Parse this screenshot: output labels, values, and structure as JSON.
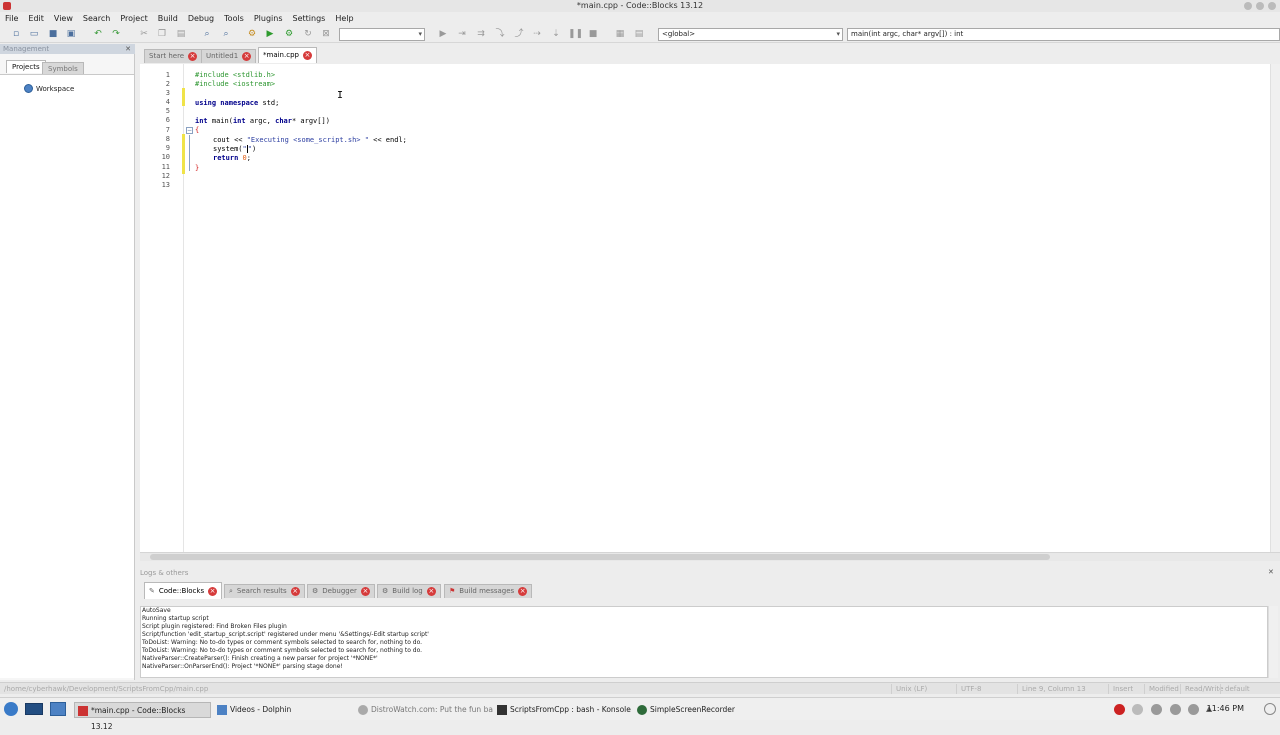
{
  "window": {
    "title": "*main.cpp - Code::Blocks 13.12"
  },
  "menu": [
    "File",
    "Edit",
    "View",
    "Search",
    "Project",
    "Build",
    "Debug",
    "Tools",
    "Plugins",
    "Settings",
    "Help"
  ],
  "toolbar": {
    "target_combo": "",
    "scope_combo": "<global>",
    "function_combo": "main(int argc, char* argv[]) : int"
  },
  "management": {
    "title": "Management",
    "tabs": [
      "Projects",
      "Symbols"
    ],
    "tree_root": "Workspace"
  },
  "editor_tabs": [
    {
      "label": "Start here",
      "active": false
    },
    {
      "label": "Untitled1",
      "active": false
    },
    {
      "label": "*main.cpp",
      "active": true
    }
  ],
  "code": {
    "line_numbers": [
      "1",
      "2",
      "3",
      "4",
      "5",
      "6",
      "7",
      "8",
      "9",
      "10",
      "11",
      "12",
      "13"
    ],
    "lines": {
      "l1": "#include <stdlib.h>",
      "l2": "#include <iostream>",
      "l4_kw1": "using",
      "l4_kw2": "namespace",
      "l4_rest": " std;",
      "l6_kw1": "int",
      "l6_mid": " main(",
      "l6_kw2": "int",
      "l6_mid2": " argc, ",
      "l6_kw3": "char",
      "l6_end": "* argv[])",
      "l7": "{",
      "l8_a": "cout << ",
      "l8_str": "\"Executing <some_script.sh> \"",
      "l8_b": " << endl;",
      "l9_a": "system(",
      "l9_str": "\"",
      "l9_b": ")",
      "l10_kw": "return",
      "l10_num": " 0",
      "l10_end": ";",
      "l11": "}"
    }
  },
  "logs": {
    "title": "Logs & others",
    "tabs": [
      "Code::Blocks",
      "Search results",
      "Debugger",
      "Build log",
      "Build messages"
    ],
    "lines": [
      "AutoSave",
      "Running startup script",
      "Script plugin registered: Find Broken Files plugin",
      "Script/function 'edit_startup_script.script' registered under menu '&Settings/-Edit startup script'",
      "ToDoList: Warning: No to-do types or comment symbols selected to search for, nothing to do.",
      "ToDoList: Warning: No to-do types or comment symbols selected to search for, nothing to do.",
      "NativeParser::CreateParser(): Finish creating a new parser for project '*NONE*'",
      "NativeParser::OnParserEnd(): Project '*NONE*' parsing stage done!"
    ]
  },
  "status": {
    "path": "/home/cyberhawk/Development/ScriptsFromCpp/main.cpp",
    "eol": "Unix (LF)",
    "encoding": "UTF-8",
    "position": "Line 9, Column 13",
    "mode": "Insert",
    "modified": "Modified",
    "rw": "Read/Write",
    "lang": "default"
  },
  "taskbar": {
    "tasks": [
      {
        "label": "*main.cpp - Code::Blocks 13.12",
        "active": true
      },
      {
        "label": "Videos - Dolphin",
        "active": false
      },
      {
        "label": "DistroWatch.com: Put the fun ba",
        "active": false
      },
      {
        "label": "ScriptsFromCpp : bash - Konsole",
        "active": false
      },
      {
        "label": "SimpleScreenRecorder",
        "active": false
      }
    ],
    "clock": "11:46 PM"
  },
  "colors": {
    "accent": "#4d82c4",
    "close": "#d63b3b",
    "modified_bar": "#f0e348"
  }
}
